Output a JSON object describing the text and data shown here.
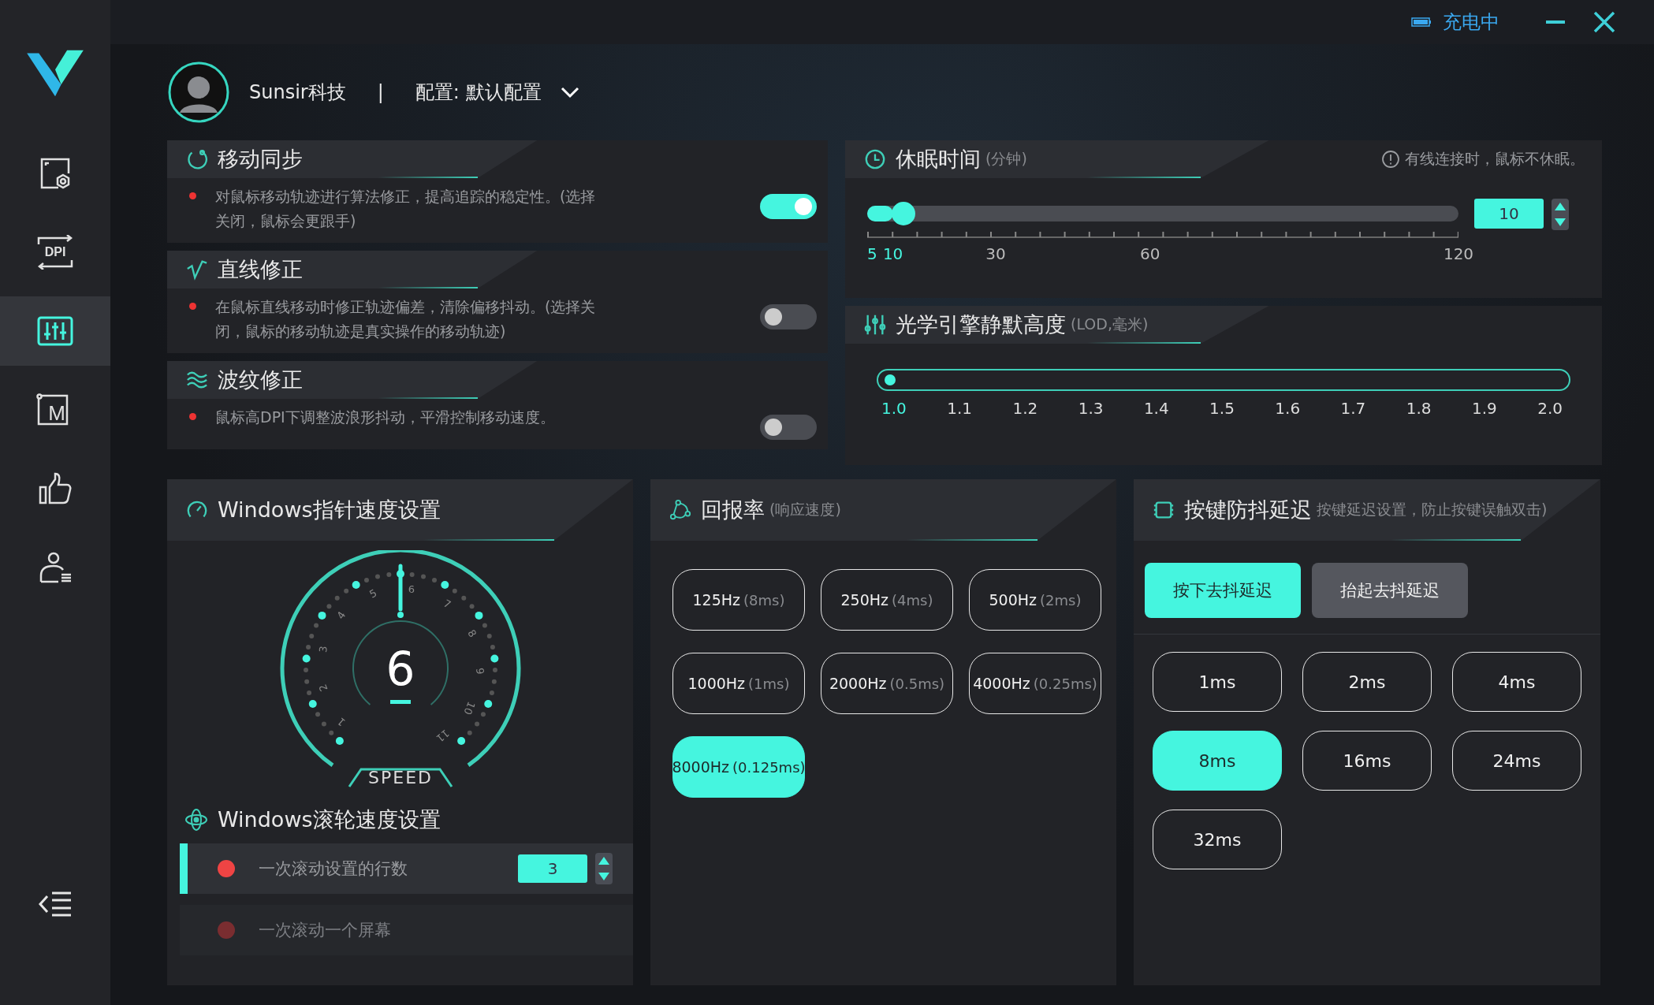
{
  "window": {
    "battery_status": "充电中"
  },
  "sidebar": {
    "items": [
      {
        "kind": "device",
        "selected": false
      },
      {
        "kind": "dpi",
        "label": "DPI",
        "selected": false
      },
      {
        "kind": "mixer",
        "selected": true
      },
      {
        "kind": "macro",
        "label": "M",
        "selected": false
      },
      {
        "kind": "like",
        "selected": false
      },
      {
        "kind": "user",
        "selected": false
      }
    ]
  },
  "profile": {
    "name": "Sunsir科技",
    "separator": "|",
    "config": "配置: 默认配置"
  },
  "toggle_cards": [
    {
      "kind": "sync",
      "title": "移动同步",
      "description": "对鼠标移动轨迹进行算法修正，提高追踪的稳定性。(选择关闭，鼠标会更跟手)",
      "on": true
    },
    {
      "kind": "line",
      "title": "直线修正",
      "description": "在鼠标直线移动时修正轨迹偏差，清除偏移抖动。(选择关闭，鼠标的移动轨迹是真实操作的移动轨迹)",
      "on": false
    },
    {
      "kind": "ripple",
      "title": "波纹修正",
      "description": "鼠标高DPI下调整波浪形抖动，平滑控制移动速度。",
      "on": false
    }
  ],
  "sleep": {
    "title": "休眠时间",
    "unit": "(分钟)",
    "note": "有线连接时，鼠标不休眠。",
    "level": 0.0435,
    "value": "10",
    "scale": [
      {
        "label": "5",
        "active": true
      },
      {
        "label": "10",
        "active": true
      },
      {
        "label": "30",
        "active": false
      },
      {
        "label": "60",
        "active": false
      },
      {
        "label": "120",
        "active": false
      }
    ]
  },
  "lod": {
    "title": "光学引擎静默高度",
    "unit": "(LOD,毫米)",
    "level": 0,
    "scale": [
      {
        "label": "1.0",
        "selected": true
      },
      {
        "label": "1.1",
        "selected": false
      },
      {
        "label": "1.2",
        "selected": false
      },
      {
        "label": "1.3",
        "selected": false
      },
      {
        "label": "1.4",
        "selected": false
      },
      {
        "label": "1.5",
        "selected": false
      },
      {
        "label": "1.6",
        "selected": false
      },
      {
        "label": "1.7",
        "selected": false
      },
      {
        "label": "1.8",
        "selected": false
      },
      {
        "label": "1.9",
        "selected": false
      },
      {
        "label": "2.0",
        "selected": false
      }
    ]
  },
  "pointer_speed": {
    "title": "Windows指针速度设置",
    "value": "6",
    "level": 0.5,
    "caption": "SPEED",
    "scale": [
      "1",
      "2",
      "3",
      "4",
      "5",
      "6",
      "7",
      "8",
      "9",
      "10",
      "11"
    ]
  },
  "scroll_speed": {
    "title": "Windows滚轮速度设置",
    "options": [
      {
        "label": "一次滚动设置的行数",
        "selected": true,
        "value": "3"
      },
      {
        "label": "一次滚动一个屏幕",
        "selected": false
      }
    ]
  },
  "report_rate": {
    "title": "回报率",
    "subtitle": "(响应速度)",
    "options": [
      {
        "rate": "125Hz",
        "latency": "(8ms)",
        "selected": false
      },
      {
        "rate": "250Hz",
        "latency": "(4ms)",
        "selected": false
      },
      {
        "rate": "500Hz",
        "latency": "(2ms)",
        "selected": false
      },
      {
        "rate": "1000Hz",
        "latency": "(1ms)",
        "selected": false
      },
      {
        "rate": "2000Hz",
        "latency": "(0.5ms)",
        "selected": false
      },
      {
        "rate": "4000Hz",
        "latency": "(0.25ms)",
        "selected": false
      },
      {
        "rate": "8000Hz",
        "latency": "(0.125ms)",
        "selected": true
      }
    ]
  },
  "debounce": {
    "title": "按键防抖延迟",
    "subtitle": "按键延迟设置，防止按键误触双击)",
    "tabs": [
      {
        "label": "按下去抖延迟",
        "selected": true
      },
      {
        "label": "抬起去抖延迟",
        "selected": false
      }
    ],
    "options": [
      {
        "label": "1ms",
        "selected": false
      },
      {
        "label": "2ms",
        "selected": false
      },
      {
        "label": "4ms",
        "selected": false
      },
      {
        "label": "8ms",
        "selected": true
      },
      {
        "label": "16ms",
        "selected": false
      },
      {
        "label": "24ms",
        "selected": false
      },
      {
        "label": "32ms",
        "selected": false
      }
    ]
  }
}
